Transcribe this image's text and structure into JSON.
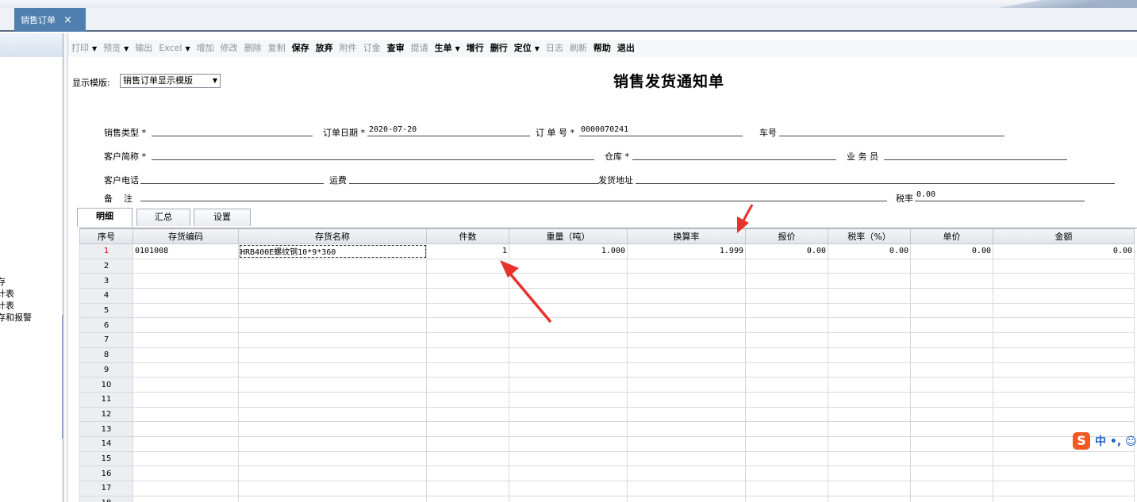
{
  "window_tab": {
    "label": "销售订单",
    "close": "×"
  },
  "left_nav": {
    "items": [
      "存",
      "计表",
      "计表",
      "存和报警"
    ]
  },
  "toolbar": [
    {
      "label": "打印",
      "enabled": false,
      "dropdown": true
    },
    {
      "label": "预览",
      "enabled": false,
      "dropdown": true
    },
    {
      "label": "输出",
      "enabled": false,
      "dropdown": false
    },
    {
      "label": "Excel",
      "enabled": false,
      "dropdown": true
    },
    {
      "label": "增加",
      "enabled": false,
      "dropdown": false
    },
    {
      "label": "修改",
      "enabled": false,
      "dropdown": false
    },
    {
      "label": "删除",
      "enabled": false,
      "dropdown": false
    },
    {
      "label": "复制",
      "enabled": false,
      "dropdown": false
    },
    {
      "label": "保存",
      "enabled": true,
      "dropdown": false
    },
    {
      "label": "放弃",
      "enabled": true,
      "dropdown": false
    },
    {
      "label": "附件",
      "enabled": false,
      "dropdown": false
    },
    {
      "label": "订金",
      "enabled": false,
      "dropdown": false
    },
    {
      "label": "查审",
      "enabled": true,
      "dropdown": false
    },
    {
      "label": "提请",
      "enabled": false,
      "dropdown": false
    },
    {
      "label": "生单",
      "enabled": true,
      "dropdown": true
    },
    {
      "label": "增行",
      "enabled": true,
      "dropdown": false
    },
    {
      "label": "删行",
      "enabled": true,
      "dropdown": false
    },
    {
      "label": "定位",
      "enabled": true,
      "dropdown": true
    },
    {
      "label": "日志",
      "enabled": false,
      "dropdown": false
    },
    {
      "label": "刷新",
      "enabled": false,
      "dropdown": false
    },
    {
      "label": "帮助",
      "enabled": true,
      "dropdown": false
    },
    {
      "label": "退出",
      "enabled": true,
      "dropdown": false
    }
  ],
  "template": {
    "label": "显示模版:",
    "value": "销售订单显示模版"
  },
  "document_title": "销售发货通知单",
  "form": {
    "sales_type": {
      "label": "销售类型",
      "required": "*",
      "value": ""
    },
    "order_date": {
      "label": "订单日期",
      "required": "*",
      "value": "2020-07-20"
    },
    "order_no": {
      "label": "订 单 号",
      "required": "*",
      "value": "0000070241"
    },
    "car_no": {
      "label": "车号",
      "value": ""
    },
    "customer": {
      "label": "客户简称",
      "required": "*",
      "value": ""
    },
    "warehouse": {
      "label": "仓库",
      "required": "*",
      "value": ""
    },
    "salesman": {
      "label": "业 务 员",
      "value": ""
    },
    "phone": {
      "label": "客户电话",
      "value": ""
    },
    "freight": {
      "label": "运费",
      "value": ""
    },
    "ship_address": {
      "label": "发货地址",
      "value": ""
    },
    "remark": {
      "label": "备    注",
      "value": ""
    },
    "tax_rate": {
      "label": "税率",
      "value": "0.00"
    }
  },
  "subtabs": [
    "明细",
    "汇总",
    "设置"
  ],
  "grid": {
    "columns": [
      "序号",
      "存货编码",
      "存货名称",
      "件数",
      "重量（吨）",
      "换算率",
      "报价",
      "税率（%）",
      "单价",
      "金额"
    ],
    "rows": [
      [
        "1",
        "0101008",
        "HRB400E螺纹钢10*9*360",
        "1",
        "1.000",
        "1.999",
        "0.00",
        "0.00",
        "0.00",
        "0.00"
      ],
      [
        "2",
        "",
        "",
        "",
        "",
        "",
        "",
        "",
        "",
        ""
      ],
      [
        "3",
        "",
        "",
        "",
        "",
        "",
        "",
        "",
        "",
        ""
      ],
      [
        "4",
        "",
        "",
        "",
        "",
        "",
        "",
        "",
        "",
        ""
      ],
      [
        "5",
        "",
        "",
        "",
        "",
        "",
        "",
        "",
        "",
        ""
      ],
      [
        "6",
        "",
        "",
        "",
        "",
        "",
        "",
        "",
        "",
        ""
      ],
      [
        "7",
        "",
        "",
        "",
        "",
        "",
        "",
        "",
        "",
        ""
      ],
      [
        "8",
        "",
        "",
        "",
        "",
        "",
        "",
        "",
        "",
        ""
      ],
      [
        "9",
        "",
        "",
        "",
        "",
        "",
        "",
        "",
        "",
        ""
      ],
      [
        "10",
        "",
        "",
        "",
        "",
        "",
        "",
        "",
        "",
        ""
      ],
      [
        "11",
        "",
        "",
        "",
        "",
        "",
        "",
        "",
        "",
        ""
      ],
      [
        "12",
        "",
        "",
        "",
        "",
        "",
        "",
        "",
        "",
        ""
      ],
      [
        "13",
        "",
        "",
        "",
        "",
        "",
        "",
        "",
        "",
        ""
      ],
      [
        "14",
        "",
        "",
        "",
        "",
        "",
        "",
        "",
        "",
        ""
      ],
      [
        "15",
        "",
        "",
        "",
        "",
        "",
        "",
        "",
        "",
        ""
      ],
      [
        "16",
        "",
        "",
        "",
        "",
        "",
        "",
        "",
        "",
        ""
      ],
      [
        "17",
        "",
        "",
        "",
        "",
        "",
        "",
        "",
        "",
        ""
      ],
      [
        "18",
        "",
        "",
        "",
        "",
        "",
        "",
        "",
        "",
        ""
      ]
    ]
  },
  "ime": {
    "logo": "S",
    "text": "中 •, ☺"
  },
  "colors": {
    "tab_active": "#4f7fae",
    "arrow": "#e8322c",
    "row_marker": "#d40000"
  }
}
